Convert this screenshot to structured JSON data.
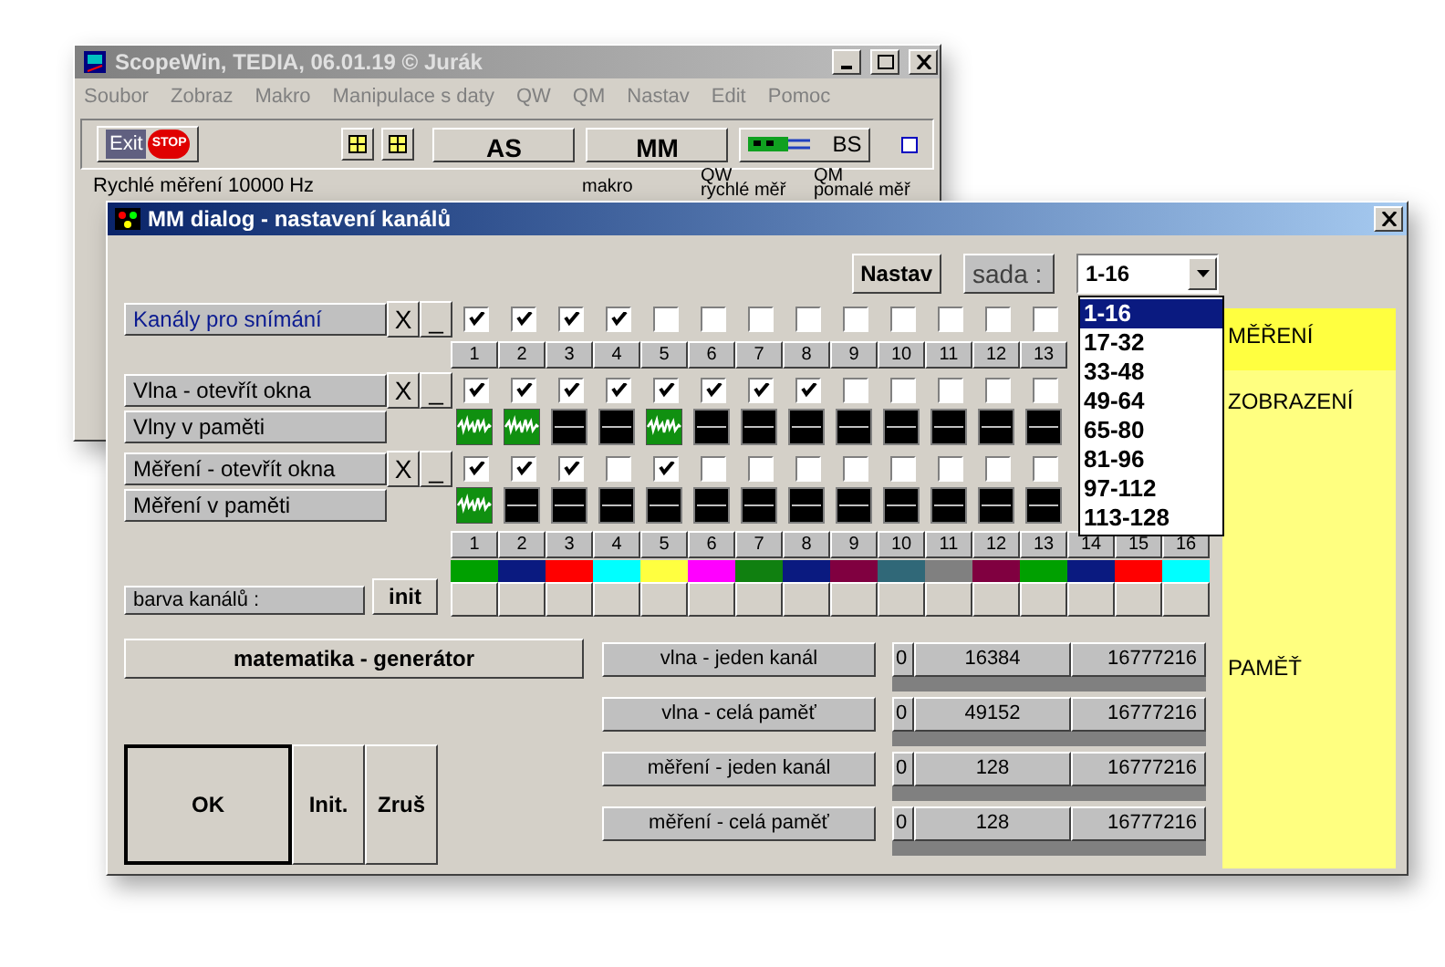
{
  "main_window": {
    "title": "ScopeWin, TEDIA,   06.01.19 © Jurák",
    "menu": [
      "Soubor",
      "Zobraz",
      "Makro",
      "Manipulace s daty",
      "QW",
      "QM",
      "Nastav",
      "Edit",
      "Pomoc"
    ],
    "toolbar": {
      "exit": "Exit",
      "stop": "STOP",
      "as": "AS",
      "mm": "MM",
      "bs": "BS"
    },
    "status": {
      "mode": "Rychlé měření  10000 Hz",
      "makro": "makro",
      "qw": "QW",
      "qw_sub": "rychlé měř",
      "qm": "QM",
      "qm_sub": "pomalé měř"
    }
  },
  "dialog": {
    "title": "MM dialog - nastavení kanálů",
    "nastav": "Nastav",
    "sada_label": "sada :",
    "sada_value": "1-16",
    "sada_options": [
      {
        "label": "1-16",
        "selected": true
      },
      {
        "label": "17-32",
        "selected": false
      },
      {
        "label": "33-48",
        "selected": false
      },
      {
        "label": "49-64",
        "selected": false
      },
      {
        "label": "65-80",
        "selected": false
      },
      {
        "label": "81-96",
        "selected": false
      },
      {
        "label": "97-112",
        "selected": false
      },
      {
        "label": "113-128",
        "selected": false
      }
    ],
    "rows": [
      {
        "kind": "checkbox",
        "label": "Kanály pro snímání",
        "active": true,
        "buttons": [
          "X",
          "_"
        ],
        "cells": [
          {
            "checked": true
          },
          {
            "checked": true
          },
          {
            "checked": true
          },
          {
            "checked": true
          },
          {
            "checked": false
          },
          {
            "checked": false
          },
          {
            "checked": false
          },
          {
            "checked": false
          },
          {
            "checked": false
          },
          {
            "checked": false
          },
          {
            "checked": false
          },
          {
            "checked": false
          },
          {
            "checked": false
          }
        ]
      },
      {
        "kind": "header",
        "labels": [
          "1",
          "2",
          "3",
          "4",
          "5",
          "6",
          "7",
          "8",
          "9",
          "10",
          "11",
          "12",
          "13"
        ]
      },
      {
        "kind": "checkbox",
        "label": "Vlna - otevřít okna",
        "active": false,
        "buttons": [
          "X",
          "_"
        ],
        "cells": [
          {
            "checked": true
          },
          {
            "checked": true
          },
          {
            "checked": true
          },
          {
            "checked": true
          },
          {
            "checked": true
          },
          {
            "checked": true
          },
          {
            "checked": true
          },
          {
            "checked": true
          },
          {
            "checked": false
          },
          {
            "checked": false
          },
          {
            "checked": false
          },
          {
            "checked": false
          },
          {
            "checked": false
          }
        ]
      },
      {
        "kind": "memory",
        "label": "Vlny v paměti",
        "cells": [
          {
            "has_wave": true
          },
          {
            "has_wave": true
          },
          {
            "has_wave": false
          },
          {
            "has_wave": false
          },
          {
            "has_wave": true
          },
          {
            "has_wave": false
          },
          {
            "has_wave": false
          },
          {
            "has_wave": false
          },
          {
            "has_wave": false
          },
          {
            "has_wave": false
          },
          {
            "has_wave": false
          },
          {
            "has_wave": false
          },
          {
            "has_wave": false
          }
        ]
      },
      {
        "kind": "checkbox",
        "label": "Měření - otevřít okna",
        "active": false,
        "buttons": [
          "X",
          "_"
        ],
        "cells": [
          {
            "checked": true
          },
          {
            "checked": true
          },
          {
            "checked": true
          },
          {
            "checked": false
          },
          {
            "checked": true
          },
          {
            "checked": false
          },
          {
            "checked": false
          },
          {
            "checked": false
          },
          {
            "checked": false
          },
          {
            "checked": false
          },
          {
            "checked": false
          },
          {
            "checked": false
          },
          {
            "checked": false
          }
        ]
      },
      {
        "kind": "memory",
        "label": "Měření v paměti",
        "cells": [
          {
            "has_wave": true
          },
          {
            "has_wave": false
          },
          {
            "has_wave": false
          },
          {
            "has_wave": false
          },
          {
            "has_wave": false
          },
          {
            "has_wave": false
          },
          {
            "has_wave": false
          },
          {
            "has_wave": false
          },
          {
            "has_wave": false
          },
          {
            "has_wave": false
          },
          {
            "has_wave": false
          },
          {
            "has_wave": false
          },
          {
            "has_wave": false
          }
        ]
      },
      {
        "kind": "header",
        "labels": [
          "1",
          "2",
          "3",
          "4",
          "5",
          "6",
          "7",
          "8",
          "9",
          "10",
          "11",
          "12",
          "13",
          "14",
          "15",
          "16"
        ]
      }
    ],
    "channel_colors": [
      {
        "color": "#00a000"
      },
      {
        "color": "#0a1a80"
      },
      {
        "color": "#ff0000"
      },
      {
        "color": "#00ffff"
      },
      {
        "color": "#ffff40"
      },
      {
        "color": "#ff00ff"
      },
      {
        "color": "#108010"
      },
      {
        "color": "#0a1a80"
      },
      {
        "color": "#800040"
      },
      {
        "color": "#306878"
      },
      {
        "color": "#808080"
      },
      {
        "color": "#800040"
      },
      {
        "color": "#00a000"
      },
      {
        "color": "#0a1a80"
      },
      {
        "color": "#ff0000"
      },
      {
        "color": "#00ffff"
      }
    ],
    "color_label": "barva kanálů :",
    "init": "init",
    "math_button": "matematika - generátor",
    "memory_table": [
      {
        "label": "vlna - jeden kanál",
        "values": [
          "0",
          "16384",
          "16777216"
        ]
      },
      {
        "label": "vlna - celá paměť",
        "values": [
          "0",
          "49152",
          "16777216"
        ]
      },
      {
        "label": "měření - jeden kanál",
        "values": [
          "0",
          "128",
          "16777216"
        ]
      },
      {
        "label": "měření - celá paměť",
        "values": [
          "0",
          "128",
          "16777216"
        ]
      }
    ],
    "footer_buttons": [
      "OK",
      "Init.",
      "Zruš"
    ],
    "side_panel": [
      {
        "label": "MĚŘENÍ",
        "selected": true
      },
      {
        "label": "ZOBRAZENÍ",
        "selected": false
      },
      {
        "label": "PAMĚŤ",
        "selected": false
      }
    ]
  }
}
